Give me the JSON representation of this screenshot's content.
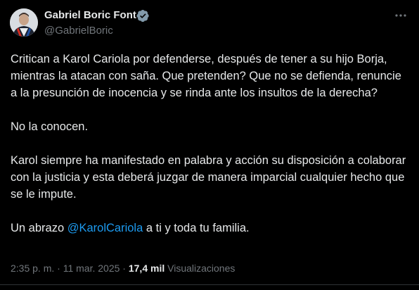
{
  "author": {
    "name": "Gabriel Boric Font",
    "handle": "@GabrielBoric",
    "verified_icon": "verified-badge-icon",
    "avatar": "avatar"
  },
  "tweet": {
    "paragraph1": "Critican a Karol Cariola por defenderse, después de tener a su hijo Borja, mientras la atacan con saña. Que pretenden? Que no se defienda, renuncie a la presunción de inocencia y se rinda ante los insultos de la derecha?",
    "paragraph2": "No la conocen.",
    "paragraph3": "Karol siempre ha manifestado en palabra y acción su disposición a colaborar con la justicia y esta deberá juzgar de manera imparcial cualquier hecho que se le impute.",
    "paragraph4_before": "Un abrazo ",
    "paragraph4_mention": "@KarolCariola",
    "paragraph4_after": " a ti y toda tu familia."
  },
  "meta": {
    "time": "2:35 p. m.",
    "separator": " · ",
    "date": "11 mar. 2025",
    "views_count": "17,4 mil",
    "views_label": "Visualizaciones"
  },
  "colors": {
    "background": "#000000",
    "text": "#e7e9ea",
    "secondary": "#71767b",
    "accent": "#1d9bf0"
  }
}
